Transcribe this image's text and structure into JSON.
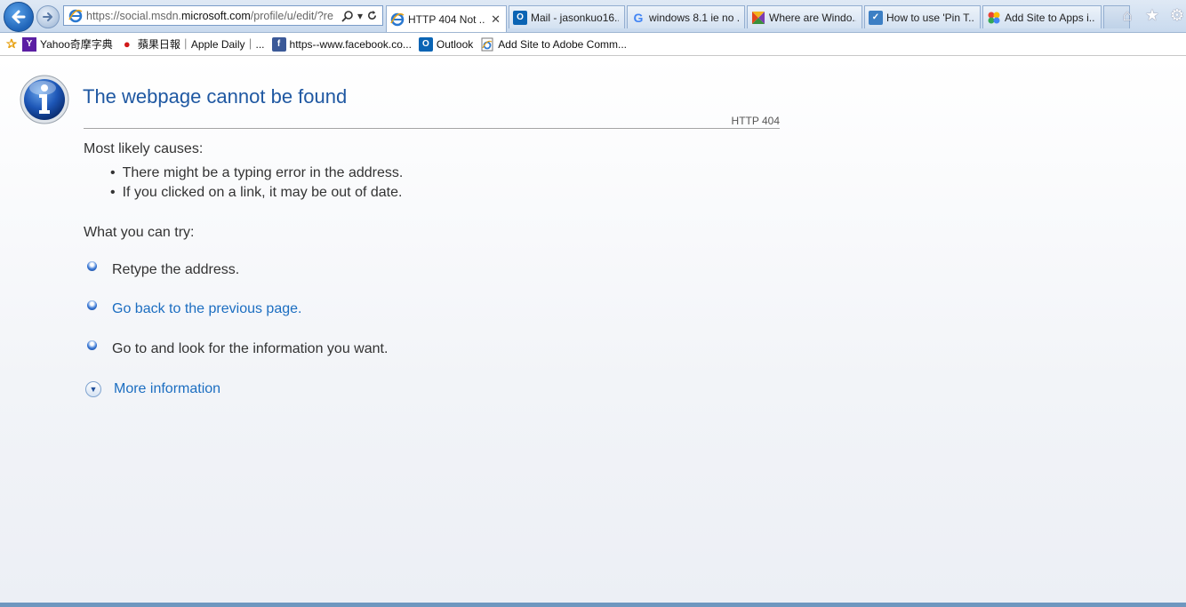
{
  "browser": {
    "address": {
      "url_prefix": "https://social.msdn.",
      "url_domain": "microsoft.com",
      "url_suffix": "/profile/u/edit/?re"
    },
    "tabs": [
      {
        "title": "HTTP 404 Not ...",
        "icon": "ie-icon",
        "active": true
      },
      {
        "title": "Mail - jasonkuo16...",
        "icon": "outlook-icon",
        "active": false
      },
      {
        "title": "windows 8.1 ie no ...",
        "icon": "google-icon",
        "active": false
      },
      {
        "title": "Where are Windo...",
        "icon": "windows-help-icon",
        "active": false
      },
      {
        "title": "How to use 'Pin T...",
        "icon": "howto-icon",
        "active": false
      },
      {
        "title": "Add Site to Apps i...",
        "icon": "apps-icon",
        "active": false
      }
    ]
  },
  "favorites": {
    "items": [
      {
        "label": "Yahoo奇摩字典",
        "icon": "yahoo-icon"
      },
      {
        "label": "蘋果日報｜Apple Daily｜...",
        "icon": "apple-daily-icon"
      },
      {
        "label": "https--www.facebook.co...",
        "icon": "facebook-icon"
      },
      {
        "label": "Outlook",
        "icon": "outlook-icon"
      },
      {
        "label": "Add Site to Adobe Comm...",
        "icon": "ie-page-icon"
      }
    ]
  },
  "page": {
    "title": "The webpage cannot be found",
    "http_code": "HTTP 404",
    "causes_heading": "Most likely causes:",
    "causes": [
      "There might be a typing error in the address.",
      "If you clicked on a link, it may be out of date."
    ],
    "try_heading": "What you can try:",
    "try_items": [
      {
        "text": "Retype the address.",
        "link": false
      },
      {
        "text": "Go back to the previous page.",
        "link": true
      },
      {
        "text": "Go to  and look for the information you want.",
        "link": false
      }
    ],
    "more_info": "More information"
  },
  "colors": {
    "title": "#1f58a2",
    "link": "#1c6ec1",
    "text": "#333333",
    "bottom_strip": "#6f97bf"
  }
}
